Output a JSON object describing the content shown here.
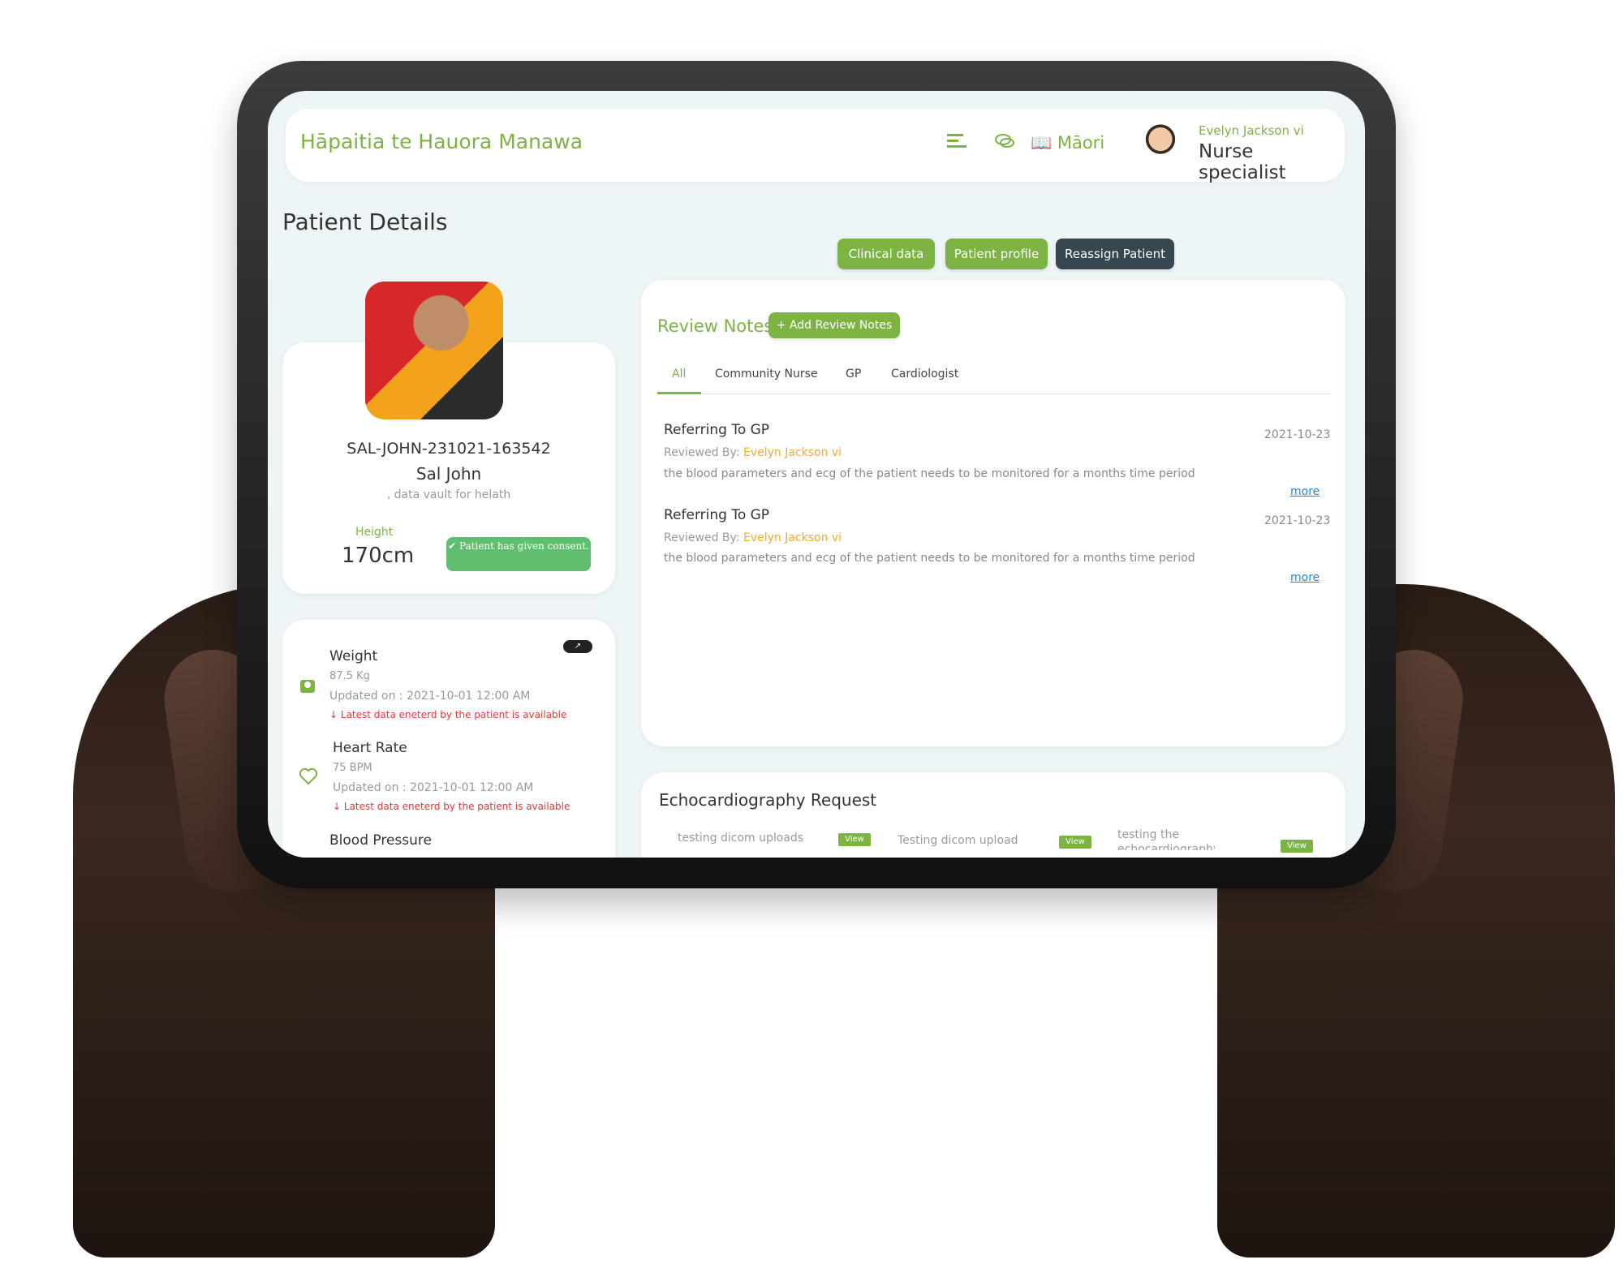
{
  "app": {
    "title": "Hāpaitia te Hauora Manawa"
  },
  "topbar": {
    "menu_icon": "menu-lines-icon",
    "chat_icon": "chat-bubbles-icon",
    "language_icon": "translate-book-icon",
    "language": "Māori",
    "user_name": "Evelyn Jackson vi",
    "user_role": "Nurse specialist"
  },
  "page": {
    "title": "Patient Details"
  },
  "actions": {
    "clinical_data": "Clinical data",
    "patient_profile": "Patient profile",
    "reassign_patient": "Reassign Patient"
  },
  "patient": {
    "id": "SAL-JOHN-231021-163542",
    "name": "Sal John",
    "subtitle": ", data vault for helath",
    "height_label": "Height",
    "height_value": "170cm",
    "consent": "Patient has given consent."
  },
  "vitals": [
    {
      "title": "Weight",
      "value": "87.5 Kg",
      "updated": "Updated on : 2021-10-01 12:00 AM",
      "warning": "Latest data eneterd by the patient is available",
      "icon": "scale-icon"
    },
    {
      "title": "Heart Rate",
      "value": "75 BPM",
      "updated": "Updated on : 2021-10-01 12:00 AM",
      "warning": "Latest data eneterd by the patient is available",
      "icon": "heart-icon"
    },
    {
      "title": "Blood Pressure"
    }
  ],
  "review_notes": {
    "title": "Review Notes",
    "add_label": "+ Add Review Notes",
    "tabs": [
      "All",
      "Community Nurse",
      "GP",
      "Cardiologist"
    ],
    "active_tab": "All",
    "notes": [
      {
        "title": "Referring To GP",
        "date": "2021-10-23",
        "reviewed_by_label": "Reviewed By:",
        "reviewer": "Evelyn Jackson vi",
        "body": "the blood parameters and ecg of the patient needs to be monitored for a months time period",
        "more": "more"
      },
      {
        "title": "Referring To GP",
        "date": "2021-10-23",
        "reviewed_by_label": "Reviewed By:",
        "reviewer": "Evelyn Jackson vi",
        "body": "the blood parameters and ecg of the patient needs to be monitored for a months time period",
        "more": "more"
      }
    ]
  },
  "echo": {
    "title": "Echocardiography Request",
    "items": [
      {
        "label": "testing dicom uploads",
        "view": "View"
      },
      {
        "label": "Testing dicom upload",
        "view": "View"
      },
      {
        "label": "testing the echocardiography",
        "view": "View"
      }
    ]
  },
  "colors": {
    "accent": "#7cb342",
    "dark_button": "#37474f",
    "warning": "#e53935",
    "reviewer": "#f9a825",
    "link": "#1e88e5"
  }
}
